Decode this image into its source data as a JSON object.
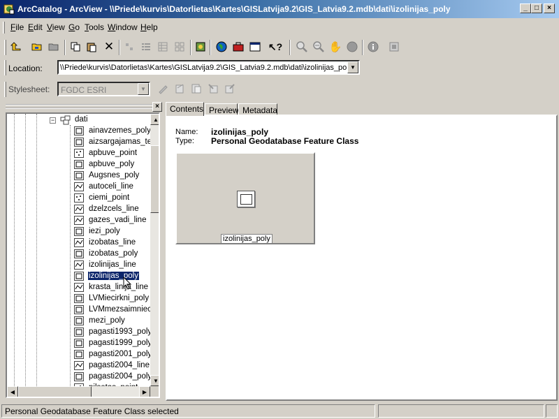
{
  "window": {
    "title": "ArcCatalog - ArcView - \\\\Priede\\kurvis\\Datorlietas\\Kartes\\GISLatvija9.2\\GIS_Latvia9.2.mdb\\dati\\izolinijas_poly",
    "controls": {
      "minimize": "_",
      "maximize": "□",
      "close": "×"
    }
  },
  "menu": [
    {
      "key": "F",
      "rest": "ile"
    },
    {
      "key": "E",
      "rest": "dit"
    },
    {
      "key": "V",
      "rest": "iew"
    },
    {
      "key": "G",
      "rest": "o"
    },
    {
      "key": "T",
      "rest": "ools"
    },
    {
      "key": "W",
      "rest": "indow"
    },
    {
      "key": "H",
      "rest": "elp"
    }
  ],
  "location": {
    "label": "Location:",
    "value": "\\\\Priede\\kurvis\\Datorlietas\\Kartes\\GISLatvija9.2\\GIS_Latvia9.2.mdb\\dati\\izolinijas_poly"
  },
  "stylesheet": {
    "label": "Stylesheet:",
    "value": "FGDC ESRI"
  },
  "tree": {
    "folder": "dati",
    "items": [
      "ainavzemes_poly",
      "aizsargajamas_ter",
      "apbuve_point",
      "apbuve_poly",
      "Augsnes_poly",
      "autoceli_line",
      "ciemi_point",
      "dzelzcels_line",
      "gazes_vadi_line",
      "iezi_poly",
      "izobatas_line",
      "izobatas_poly",
      "izolinijas_line",
      "izolinijas_poly",
      "krasta_linija_line",
      "LVMiecirkni_poly",
      "LVMmezsaimnieciba",
      "mezi_poly",
      "pagasti1993_poly",
      "pagasti1999_poly",
      "pagasti2001_poly",
      "pagasti2004_line",
      "pagasti2004_poly",
      "pilsetas_point"
    ],
    "selected": "izolinijas_poly"
  },
  "tabs": [
    "Contents",
    "Preview",
    "Metadata"
  ],
  "contents": {
    "name_label": "Name:",
    "name_value": "izolinijas_poly",
    "type_label": "Type:",
    "type_value": "Personal Geodatabase Feature Class",
    "thumbnail_caption": "izolinijas_poly"
  },
  "status": {
    "text": "Personal Geodatabase Feature Class selected"
  }
}
